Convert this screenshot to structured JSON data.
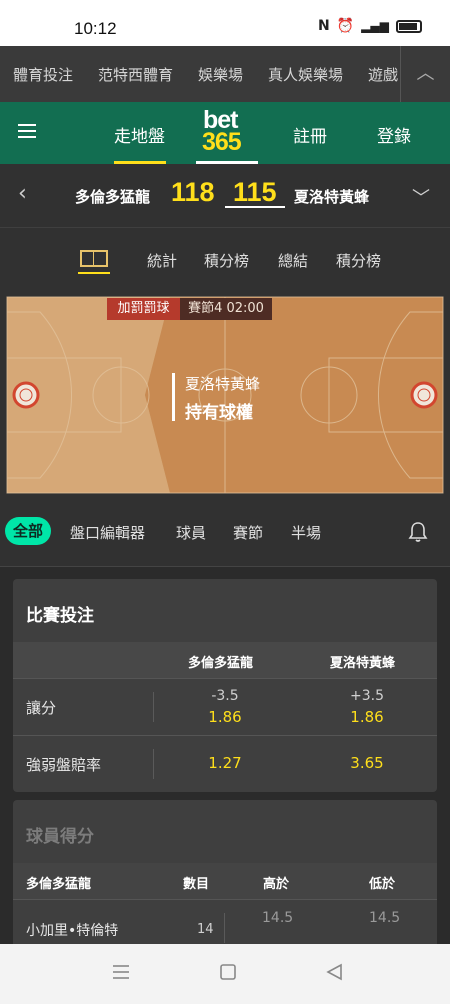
{
  "status_bar": {
    "time": "10:12"
  },
  "category_nav": {
    "items": [
      "體育投注",
      "范特西體育",
      "娛樂場",
      "真人娛樂場",
      "遊戲"
    ]
  },
  "header": {
    "inplay": "走地盤",
    "logo_top": "bet",
    "logo_bottom": "365",
    "register": "註冊",
    "login": "登錄"
  },
  "scoreboard": {
    "home_team": "多倫多猛龍",
    "home_score": "118",
    "away_score": "115",
    "away_team": "夏洛特黃蜂"
  },
  "match_tabs": [
    "統計",
    "積分榜",
    "總結",
    "積分榜"
  ],
  "court": {
    "badge_event": "加罰罰球",
    "badge_period": "賽節4  02:00",
    "possession_team": "夏洛特黃蜂",
    "possession_label": "持有球權"
  },
  "market_filter": {
    "all": "全部",
    "items": [
      "盤口編輯器",
      "球員",
      "賽節",
      "半場"
    ]
  },
  "match_betting": {
    "title": "比賽投注",
    "col_home": "多倫多猛龍",
    "col_away": "夏洛特黃蜂",
    "rows": [
      {
        "label": "讓分",
        "home_line": "-3.5",
        "home_odds": "1.86",
        "away_line": "+3.5",
        "away_odds": "1.86"
      },
      {
        "label": "強弱盤賠率",
        "home_odds": "1.27",
        "away_odds": "3.65"
      }
    ]
  },
  "player_points": {
    "title": "球員得分",
    "col_team": "多倫多猛龍",
    "col_count": "數目",
    "col_over": "高於",
    "col_under": "低於",
    "rows": [
      {
        "player": "小加里•特倫特",
        "count": "14",
        "over": "14.5",
        "under": "14.5"
      }
    ]
  },
  "colors": {
    "brand_green": "#126e51",
    "accent_yellow": "#ffdf1b",
    "filter_active": "#00e6a8"
  }
}
